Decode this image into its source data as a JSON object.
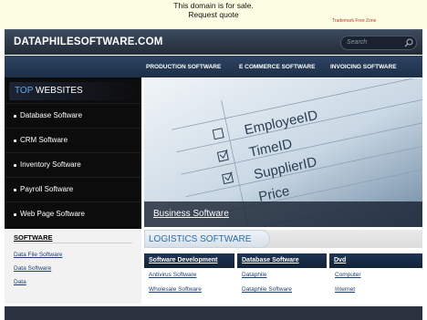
{
  "banner": {
    "line1": "This domain is for sale.",
    "line2": "Request quote",
    "trademark": "Trademark Free Zone"
  },
  "header": {
    "title": "DATAPHILESOFTWARE.COM",
    "search_placeholder": "Search"
  },
  "nav": {
    "items": [
      "PRODUCTION SOFTWARE",
      "E COMMERCE SOFTWARE",
      "INVOICING SOFTWARE"
    ]
  },
  "sidebar": {
    "heading_top": "TOP",
    "heading_rest": "WEBSITES",
    "items": [
      "Database Software",
      "CRM Software",
      "Inventory Software",
      "Payroll Software",
      "Web Page Software"
    ]
  },
  "hero": {
    "caption": "Business Software",
    "image_words": [
      "EmployeeID",
      "TimeID",
      "SupplierID",
      "Price"
    ]
  },
  "software": {
    "heading": "SOFTWARE",
    "links": [
      "Data File Software",
      "Data Software",
      "Data"
    ]
  },
  "logistics": {
    "heading": "LOGISTICS SOFTWARE",
    "columns": [
      {
        "title": "Software Development",
        "links": [
          "Antivirus Software",
          "Wholesale Software"
        ]
      },
      {
        "title": "Database Software",
        "links": [
          "Dataphile",
          "Dataphile Software"
        ]
      },
      {
        "title": "Dvd",
        "links": [
          "Computer",
          "Internet"
        ]
      }
    ]
  }
}
